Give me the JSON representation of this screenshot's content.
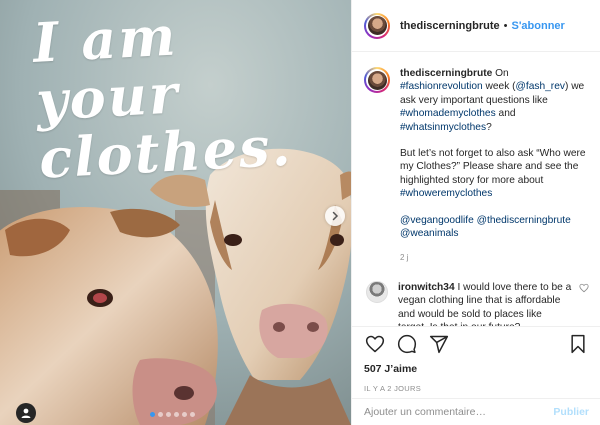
{
  "post": {
    "overlay_lines": [
      "I am",
      "your",
      "clothes."
    ],
    "carousel": {
      "dots": 6,
      "active_index": 0,
      "active_color": "#3897f0"
    }
  },
  "header": {
    "username": "thediscerningbrute",
    "separator": "•",
    "follow_label": "S'abonner"
  },
  "caption": {
    "username": "thediscerningbrute",
    "p1": [
      {
        "t": "text",
        "v": " On "
      },
      {
        "t": "link",
        "v": "#fashionrevolution"
      },
      {
        "t": "text",
        "v": " week ("
      },
      {
        "t": "link",
        "v": "@fash_rev"
      },
      {
        "t": "text",
        "v": ") we ask very important questions like "
      },
      {
        "t": "link",
        "v": "#whomademyclothes"
      },
      {
        "t": "text",
        "v": " and "
      },
      {
        "t": "link",
        "v": "#whatsinmyclothes"
      },
      {
        "t": "text",
        "v": "?"
      }
    ],
    "p2_before": "But let’s not forget to also ask “Who were my Clothes?” Please share and see the highlighted story for more about ",
    "p2_link": "#whoweremyclothes",
    "mentions": [
      "@vegangoodlife",
      "@thediscerningbrute",
      "@weanimals"
    ],
    "time_ago": "2 j"
  },
  "comment": {
    "username": "ironwitch34",
    "text": "I would love there to be a vegan clothing line that is affordable and would be sold to places like target. Is that in our future?"
  },
  "actions": {
    "likes": "507 J’aime",
    "posted": "IL Y A 2 JOURS"
  },
  "add_comment": {
    "placeholder": "Ajouter un commentaire…",
    "publish_label": "Publier"
  }
}
